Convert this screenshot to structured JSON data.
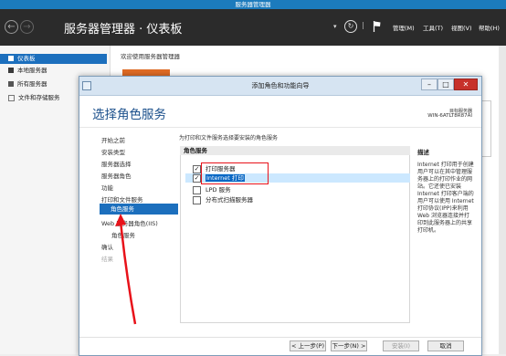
{
  "server_manager": {
    "window_title": "服务器管理器",
    "header_title": "服务器管理器 · 仪表板",
    "menu": [
      "管理(M)",
      "工具(T)",
      "视图(V)",
      "帮助(H)"
    ],
    "sidebar": [
      {
        "label": "仪表板",
        "icon": "dashboard-icon",
        "selected": true
      },
      {
        "label": "本地服务器",
        "icon": "local-server-icon"
      },
      {
        "label": "所有服务器",
        "icon": "all-servers-icon"
      },
      {
        "label": "文件和存储服务",
        "icon": "file-storage-icon"
      }
    ],
    "welcome": "欢迎使用服务器管理器",
    "colors": {
      "title_bar": "#1c7bbd",
      "header_bg": "#2b2b2b",
      "accent": "#e06b24"
    }
  },
  "wizard": {
    "title": "添加角色和功能向导",
    "heading": "选择角色服务",
    "target_label": "目标服务器",
    "target_server": "WIN-6ATLT8R87AI",
    "nav": [
      {
        "label": "开始之前",
        "level": 0
      },
      {
        "label": "安装类型",
        "level": 0
      },
      {
        "label": "服务器选择",
        "level": 0
      },
      {
        "label": "服务器角色",
        "level": 0
      },
      {
        "label": "功能",
        "level": 0
      },
      {
        "label": "打印和文件服务",
        "level": 0
      },
      {
        "label": "角色服务",
        "level": 1,
        "selected": true
      },
      {
        "label": "Web 服务器角色(IIS)",
        "level": 0
      },
      {
        "label": "角色服务",
        "level": 1
      },
      {
        "label": "确认",
        "level": 0
      },
      {
        "label": "结果",
        "level": 0,
        "disabled": true
      }
    ],
    "instruction": "为打印和文件服务选择要安装的角色服务",
    "list_header": "角色服务",
    "role_services": [
      {
        "label": "打印服务器",
        "checked": true
      },
      {
        "label": "Internet 打印",
        "checked": true,
        "selected": true
      },
      {
        "label": "LPD 服务",
        "checked": false
      },
      {
        "label": "分布式扫描服务器",
        "checked": false,
        "expandable": true
      }
    ],
    "description_title": "描述",
    "description_text": "Internet 打印用于创建用户可以在其中管理服务器上的打印作业的网站。它还使已安装 Internet 打印客户端的用户可以使用 Internet 打印协议(IPP)来利用 Web 浏览器连接并打印到此服务器上的共享打印机。",
    "buttons": {
      "prev": "< 上一步(P)",
      "next": "下一步(N) >",
      "install": "安装(I)",
      "cancel": "取消"
    },
    "colors": {
      "heading": "#1a4f8b",
      "selection": "#1c6fbd",
      "highlight_box": "#e8121a"
    }
  }
}
